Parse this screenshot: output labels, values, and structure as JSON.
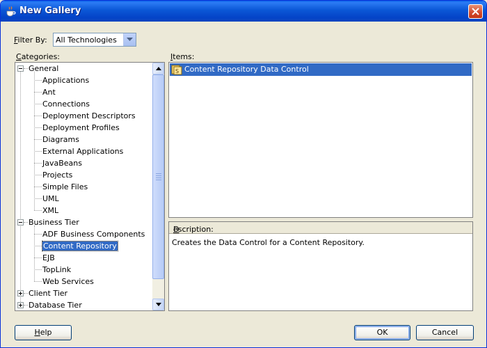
{
  "window": {
    "title": "New Gallery"
  },
  "filter": {
    "label_pre": "",
    "label_key": "F",
    "label_post": "ilter By:",
    "value": "All Technologies"
  },
  "categories": {
    "label_key": "C",
    "label_post": "ategories:",
    "tree": [
      {
        "label": "General",
        "level": 0,
        "expander": "minus"
      },
      {
        "label": "Applications",
        "level": 1
      },
      {
        "label": "Ant",
        "level": 1
      },
      {
        "label": "Connections",
        "level": 1
      },
      {
        "label": "Deployment Descriptors",
        "level": 1
      },
      {
        "label": "Deployment Profiles",
        "level": 1
      },
      {
        "label": "Diagrams",
        "level": 1
      },
      {
        "label": "External Applications",
        "level": 1
      },
      {
        "label": "JavaBeans",
        "level": 1
      },
      {
        "label": "Projects",
        "level": 1
      },
      {
        "label": "Simple Files",
        "level": 1
      },
      {
        "label": "UML",
        "level": 1
      },
      {
        "label": "XML",
        "level": 1
      },
      {
        "label": "Business Tier",
        "level": 0,
        "expander": "minus"
      },
      {
        "label": "ADF Business Components",
        "level": 1
      },
      {
        "label": "Content Repository",
        "level": 1,
        "selected": true
      },
      {
        "label": "EJB",
        "level": 1
      },
      {
        "label": "TopLink",
        "level": 1
      },
      {
        "label": "Web Services",
        "level": 1
      },
      {
        "label": "Client Tier",
        "level": 0,
        "expander": "plus"
      },
      {
        "label": "Database Tier",
        "level": 0,
        "expander": "plus"
      }
    ]
  },
  "items": {
    "label_key": "I",
    "label_post": "tems:",
    "rows": [
      {
        "label": "Content Repository Data Control",
        "icon": "data-control-icon",
        "selected": true
      }
    ]
  },
  "description": {
    "label_key": "D",
    "label_post": "escription:",
    "text": "Creates the Data Control for a Content Repository."
  },
  "buttons": {
    "help_key": "H",
    "help_post": "elp",
    "ok": "OK",
    "cancel": "Cancel"
  },
  "colors": {
    "selection": "#316ac5",
    "titlebar": "#0b57d6",
    "dialog_bg": "#ece9d8"
  }
}
